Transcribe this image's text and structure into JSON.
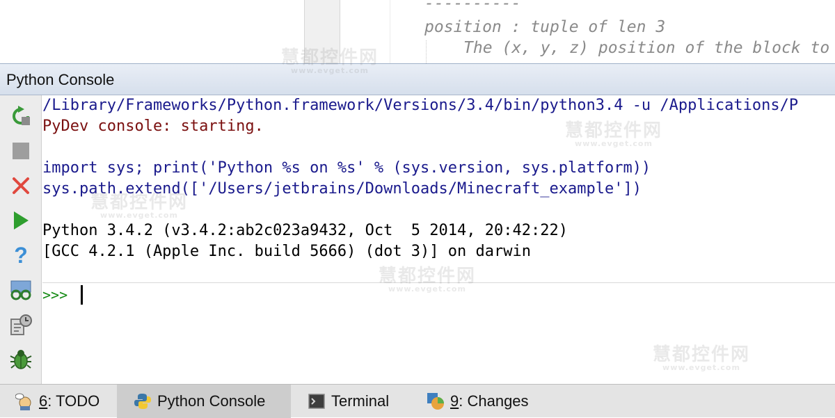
{
  "editor": {
    "line1": "----------",
    "line2": "position : tuple of len 3",
    "line3": "The (x, y, z) position of the block to"
  },
  "panel": {
    "title": "Python Console"
  },
  "toolbar": {
    "buttons": [
      {
        "icon": "rerun-icon"
      },
      {
        "icon": "stop-icon"
      },
      {
        "icon": "close-icon"
      },
      {
        "icon": "execute-icon"
      },
      {
        "icon": "help-icon"
      },
      {
        "icon": "show-variables-icon"
      },
      {
        "icon": "history-icon"
      },
      {
        "icon": "debug-icon"
      }
    ]
  },
  "console": {
    "lines": [
      {
        "text": "/Library/Frameworks/Python.framework/Versions/3.4/bin/python3.4 -u /Applications/P",
        "kind": "cmd"
      },
      {
        "text": "PyDev console: starting.",
        "kind": "info"
      },
      {
        "text": "",
        "kind": "out"
      },
      {
        "text": "import sys; print('Python %s on %s' % (sys.version, sys.platform))",
        "kind": "cmd"
      },
      {
        "text": "sys.path.extend(['/Users/jetbrains/Downloads/Minecraft_example'])",
        "kind": "cmd"
      },
      {
        "text": "",
        "kind": "out"
      },
      {
        "text": "Python 3.4.2 (v3.4.2:ab2c023a9432, Oct  5 2014, 20:42:22)",
        "kind": "out"
      },
      {
        "text": "[GCC 4.2.1 (Apple Inc. build 5666) (dot 3)] on darwin",
        "kind": "out"
      }
    ],
    "prompt": ">>>"
  },
  "tool_tabs": [
    {
      "mnemonic": "6",
      "label": ": TODO",
      "icon": "todo-icon",
      "active": false
    },
    {
      "mnemonic": "",
      "label": "Python Console",
      "icon": "python-icon",
      "active": true
    },
    {
      "mnemonic": "",
      "label": "Terminal",
      "icon": "terminal-icon",
      "active": false
    },
    {
      "mnemonic": "9",
      "label": ": Changes",
      "icon": "changes-icon",
      "active": false
    }
  ],
  "watermark": {
    "text": "慧都控件网",
    "sub": "www.evget.com"
  },
  "colors": {
    "command": "#1a1a8c",
    "info": "#7a0f0f",
    "prompt": "#148a14",
    "header_bg": "#dfe6f0"
  }
}
